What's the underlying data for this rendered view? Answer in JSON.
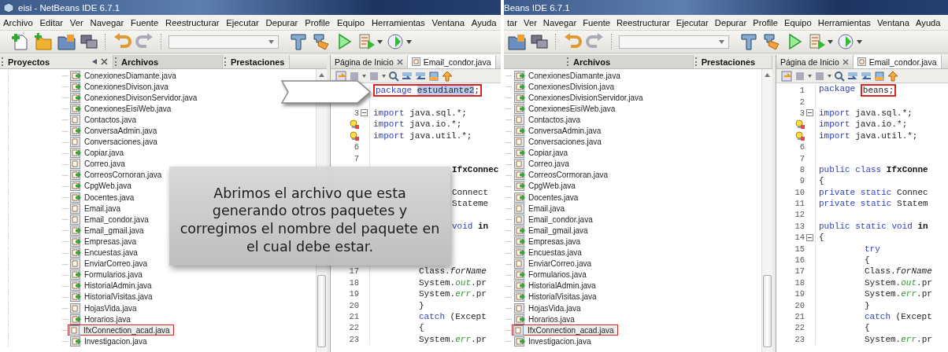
{
  "screens": [
    {
      "title": "eisi - NetBeans IDE 6.7.1",
      "menu": [
        "Archivo",
        "Editar",
        "Ver",
        "Navegar",
        "Fuente",
        "Reestructurar",
        "Ejecutar",
        "Depurar",
        "Profile",
        "Equipo",
        "Herramientas",
        "Ventana",
        "Ayuda"
      ],
      "toolbar": [
        {
          "kind": "new-file"
        },
        {
          "kind": "new-project"
        },
        {
          "kind": "open-project"
        },
        {
          "kind": "close-project"
        },
        {
          "kind": "sep"
        },
        {
          "kind": "undo"
        },
        {
          "kind": "redo"
        },
        {
          "kind": "sep"
        },
        {
          "kind": "combo"
        },
        {
          "kind": "build"
        },
        {
          "kind": "clean"
        },
        {
          "kind": "run"
        },
        {
          "kind": "debug"
        },
        {
          "kind": "profile"
        }
      ],
      "panel_tabs": [
        {
          "label": "Proyectos",
          "selected": false
        },
        {
          "label": "Archivos",
          "selected": true
        },
        {
          "label": "Prestaciones",
          "selected": false
        }
      ],
      "editor_tabs": [
        {
          "label": "Página de Inicio",
          "selected": false
        },
        {
          "label": "Email_condor.java",
          "selected": true
        }
      ],
      "files": [
        {
          "name": "ConexionesDiamante.java",
          "kind": "runnable",
          "highlighted": false
        },
        {
          "name": "ConexionesDivison.java",
          "kind": "runnable",
          "highlighted": false
        },
        {
          "name": "ConexionesDivisonServidor.java",
          "kind": "runnable",
          "highlighted": false
        },
        {
          "name": "ConexionesEisiWeb.java",
          "kind": "runnable",
          "highlighted": false
        },
        {
          "name": "Contactos.java",
          "kind": "plain",
          "highlighted": false
        },
        {
          "name": "ConversaAdmin.java",
          "kind": "runnable",
          "highlighted": false
        },
        {
          "name": "Conversaciones.java",
          "kind": "plain",
          "highlighted": false
        },
        {
          "name": "Copiar.java",
          "kind": "runnable",
          "highlighted": false
        },
        {
          "name": "Correo.java",
          "kind": "plain",
          "highlighted": false
        },
        {
          "name": "CorreosCornoran.java",
          "kind": "runnable",
          "highlighted": false
        },
        {
          "name": "CpgWeb.java",
          "kind": "runnable",
          "highlighted": false
        },
        {
          "name": "Docentes.java",
          "kind": "runnable",
          "highlighted": false
        },
        {
          "name": "Email.java",
          "kind": "plain",
          "highlighted": false
        },
        {
          "name": "Email_condor.java",
          "kind": "plain",
          "highlighted": false
        },
        {
          "name": "Email_gmail.java",
          "kind": "runnable",
          "highlighted": false
        },
        {
          "name": "Empresas.java",
          "kind": "runnable",
          "highlighted": false
        },
        {
          "name": "Encuestas.java",
          "kind": "runnable",
          "highlighted": false
        },
        {
          "name": "EnviarCorreo.java",
          "kind": "plain",
          "highlighted": false
        },
        {
          "name": "Formularios.java",
          "kind": "runnable",
          "highlighted": false
        },
        {
          "name": "HistorialAdmin.java",
          "kind": "runnable",
          "highlighted": false
        },
        {
          "name": "HistorialVisitas.java",
          "kind": "runnable",
          "highlighted": false
        },
        {
          "name": "HojasVida.java",
          "kind": "plain",
          "highlighted": false
        },
        {
          "name": "Horarios.java",
          "kind": "runnable",
          "highlighted": false
        },
        {
          "name": "IfxConnection_acad.java",
          "kind": "plain",
          "highlighted": true
        },
        {
          "name": "Investigacion.java",
          "kind": "runnable",
          "highlighted": false
        }
      ],
      "code": [
        {
          "segments": [
            {
              "text": "package ",
              "kind": "kw",
              "boxed": true,
              "selected": false
            },
            {
              "text": "estudiante2",
              "kind": "plain",
              "boxed": true,
              "selected": true
            },
            {
              "text": ";",
              "kind": "plain",
              "boxed": true,
              "selected": false
            }
          ]
        },
        {
          "kind": "blank"
        },
        {
          "number": "3",
          "kind": "fold",
          "segments": [
            {
              "text": "import ",
              "kind": "kw"
            },
            {
              "text": "java.sql.*;",
              "kind": "plain"
            }
          ]
        },
        {
          "kind": "bulb",
          "segments": [
            {
              "text": "import ",
              "kind": "kw"
            },
            {
              "text": "java.io.*;",
              "kind": "plain"
            }
          ]
        },
        {
          "kind": "bulb",
          "segments": [
            {
              "text": "import ",
              "kind": "kw"
            },
            {
              "text": "java.util.*;",
              "kind": "plain"
            }
          ]
        },
        {
          "number": "6"
        },
        {
          "number": "7"
        },
        {
          "partly_covered": true,
          "segments": [
            {
              "text": "IfxConnec",
              "kind": "bold"
            }
          ]
        },
        {
          "kind": "blank"
        },
        {
          "partly_covered": true,
          "segments": [
            {
              "text": "Connect",
              "kind": "plain"
            }
          ]
        },
        {
          "partly_covered": true,
          "segments": [
            {
              "text": "Stateme",
              "kind": "plain"
            }
          ]
        },
        {
          "kind": "blank"
        },
        {
          "partly_covered": true,
          "segments": [
            {
              "text": "void ",
              "kind": "kw"
            },
            {
              "text": "in",
              "kind": "bold"
            }
          ]
        },
        {
          "kind": "blank"
        },
        {
          "kind": "blank"
        },
        {
          "kind": "blank"
        },
        {
          "number": "17",
          "indented": true,
          "segments": [
            {
              "text": "Class.",
              "kind": "plain"
            },
            {
              "text": "forName",
              "kind": "italic"
            }
          ]
        },
        {
          "number": "18",
          "indented": true,
          "segments": [
            {
              "text": "System.",
              "kind": "plain"
            },
            {
              "text": "out",
              "kind": "field"
            },
            {
              "text": ".pr",
              "kind": "plain"
            }
          ]
        },
        {
          "number": "19",
          "indented": true,
          "segments": [
            {
              "text": "System.",
              "kind": "plain"
            },
            {
              "text": "err",
              "kind": "field"
            },
            {
              "text": ".pr",
              "kind": "plain"
            }
          ]
        },
        {
          "number": "20",
          "indented": true,
          "segments": [
            {
              "text": "}",
              "kind": "plain"
            }
          ]
        },
        {
          "number": "21",
          "indented": true,
          "segments": [
            {
              "text": "catch ",
              "kind": "kw"
            },
            {
              "text": "(Except",
              "kind": "plain"
            }
          ]
        },
        {
          "number": "22",
          "indented": true,
          "segments": [
            {
              "text": "{",
              "kind": "plain"
            }
          ]
        },
        {
          "number": "23",
          "indented": true,
          "segments": [
            {
              "text": "System.",
              "kind": "plain"
            },
            {
              "text": "err",
              "kind": "field"
            },
            {
              "text": ".pr",
              "kind": "plain"
            }
          ]
        }
      ]
    },
    {
      "title": "Beans IDE 6.7.1",
      "menu": [
        "tar",
        "Ver",
        "Navegar",
        "Fuente",
        "Reestructurar",
        "Ejecutar",
        "Depurar",
        "Profile",
        "Equipo",
        "Herramientas",
        "Ventana",
        "Ayuda"
      ],
      "toolbar": [
        {
          "kind": "open-project"
        },
        {
          "kind": "close-project"
        },
        {
          "kind": "sep"
        },
        {
          "kind": "undo"
        },
        {
          "kind": "redo"
        },
        {
          "kind": "sep"
        },
        {
          "kind": "combo"
        },
        {
          "kind": "build"
        },
        {
          "kind": "clean"
        },
        {
          "kind": "run"
        },
        {
          "kind": "debug"
        },
        {
          "kind": "profile"
        }
      ],
      "panel_tabs": [
        {
          "label": "Archivos",
          "selected": true
        },
        {
          "label": "Prestaciones",
          "selected": false
        }
      ],
      "editor_tabs": [
        {
          "label": "Página de Inicio",
          "selected": false
        },
        {
          "label": "Email_condor.java",
          "selected": true
        }
      ],
      "files": [
        {
          "name": "ConexionesDiamante.java",
          "kind": "runnable",
          "highlighted": false
        },
        {
          "name": "ConexionesDivision.java",
          "kind": "runnable",
          "highlighted": false
        },
        {
          "name": "ConexionesDivisionServidor.java",
          "kind": "runnable",
          "highlighted": false
        },
        {
          "name": "ConexionesEisiWeb.java",
          "kind": "runnable",
          "highlighted": false
        },
        {
          "name": "Contactos.java",
          "kind": "plain",
          "highlighted": false
        },
        {
          "name": "ConversaAdmin.java",
          "kind": "runnable",
          "highlighted": false
        },
        {
          "name": "Conversaciones.java",
          "kind": "plain",
          "highlighted": false
        },
        {
          "name": "Copiar.java",
          "kind": "runnable",
          "highlighted": false
        },
        {
          "name": "Correo.java",
          "kind": "plain",
          "highlighted": false
        },
        {
          "name": "CorreosCormoran.java",
          "kind": "runnable",
          "highlighted": false
        },
        {
          "name": "CpgWeb.java",
          "kind": "runnable",
          "highlighted": false
        },
        {
          "name": "Docentes.java",
          "kind": "runnable",
          "highlighted": false
        },
        {
          "name": "Email.java",
          "kind": "plain",
          "highlighted": false
        },
        {
          "name": "Email_condor.java",
          "kind": "plain",
          "highlighted": false
        },
        {
          "name": "Email_gmail.java",
          "kind": "runnable",
          "highlighted": false
        },
        {
          "name": "Empresas.java",
          "kind": "runnable",
          "highlighted": false
        },
        {
          "name": "Encuestas.java",
          "kind": "runnable",
          "highlighted": false
        },
        {
          "name": "EnviarCorreo.java",
          "kind": "plain",
          "highlighted": false
        },
        {
          "name": "Formularios.java",
          "kind": "runnable",
          "highlighted": false
        },
        {
          "name": "HistorialAdmin.java",
          "kind": "runnable",
          "highlighted": false
        },
        {
          "name": "HistorialVisitas.java",
          "kind": "runnable",
          "highlighted": false
        },
        {
          "name": "HojasVida.java",
          "kind": "plain",
          "highlighted": false
        },
        {
          "name": "Horarios.java",
          "kind": "runnable",
          "highlighted": false
        },
        {
          "name": "IfxConnection_acad.java",
          "kind": "plain",
          "highlighted": true
        },
        {
          "name": "Investigacion.java",
          "kind": "runnable",
          "highlighted": false
        }
      ],
      "code": [
        {
          "number": "1",
          "segments": [
            {
              "text": "package ",
              "kind": "kw",
              "boxed": false
            },
            {
              "text": "beans;",
              "kind": "plain",
              "boxed": true
            }
          ]
        },
        {
          "number": "2"
        },
        {
          "number": "3",
          "kind": "fold",
          "segments": [
            {
              "text": "import ",
              "kind": "kw"
            },
            {
              "text": "java.sql.*;",
              "kind": "plain"
            }
          ]
        },
        {
          "kind": "bulb",
          "segments": [
            {
              "text": "import ",
              "kind": "kw"
            },
            {
              "text": "java.io.*;",
              "kind": "plain"
            }
          ]
        },
        {
          "kind": "bulb",
          "segments": [
            {
              "text": "import ",
              "kind": "kw"
            },
            {
              "text": "java.util.*;",
              "kind": "plain"
            }
          ]
        },
        {
          "number": "6"
        },
        {
          "number": "7"
        },
        {
          "number": "8",
          "segments": [
            {
              "text": "public class ",
              "kind": "kw"
            },
            {
              "text": "IfxConne",
              "kind": "bold"
            }
          ]
        },
        {
          "number": "9",
          "segments": [
            {
              "text": "{",
              "kind": "plain"
            }
          ]
        },
        {
          "number": "10",
          "segments": [
            {
              "text": "private static ",
              "kind": "kw"
            },
            {
              "text": "Connec",
              "kind": "plain"
            }
          ]
        },
        {
          "number": "11",
          "segments": [
            {
              "text": "private static ",
              "kind": "kw"
            },
            {
              "text": "Statem",
              "kind": "plain"
            }
          ]
        },
        {
          "number": "12"
        },
        {
          "number": "13",
          "segments": [
            {
              "text": "public static void ",
              "kind": "kw"
            },
            {
              "text": "in",
              "kind": "bold"
            }
          ]
        },
        {
          "number": "14",
          "kind": "fold",
          "segments": [
            {
              "text": "{",
              "kind": "plain"
            }
          ]
        },
        {
          "number": "15",
          "indented": true,
          "segments": [
            {
              "text": "try",
              "kind": "kw"
            }
          ]
        },
        {
          "number": "16",
          "indented": true,
          "segments": [
            {
              "text": "{",
              "kind": "plain"
            }
          ]
        },
        {
          "number": "17",
          "indented": true,
          "segments": [
            {
              "text": "Class.",
              "kind": "plain"
            },
            {
              "text": "forName",
              "kind": "italic"
            }
          ]
        },
        {
          "number": "18",
          "indented": true,
          "segments": [
            {
              "text": "System.",
              "kind": "plain"
            },
            {
              "text": "out",
              "kind": "field"
            },
            {
              "text": ".pr",
              "kind": "plain"
            }
          ]
        },
        {
          "number": "19",
          "indented": true,
          "segments": [
            {
              "text": "System.",
              "kind": "plain"
            },
            {
              "text": "err",
              "kind": "field"
            },
            {
              "text": ".pr",
              "kind": "plain"
            }
          ]
        },
        {
          "number": "20",
          "indented": true,
          "segments": [
            {
              "text": "}",
              "kind": "plain"
            }
          ]
        },
        {
          "number": "21",
          "indented": true,
          "segments": [
            {
              "text": "catch ",
              "kind": "kw"
            },
            {
              "text": "(Except",
              "kind": "plain"
            }
          ]
        },
        {
          "number": "22",
          "indented": true,
          "segments": [
            {
              "text": "{",
              "kind": "plain"
            }
          ]
        },
        {
          "number": "23",
          "indented": true,
          "segments": [
            {
              "text": "System.",
              "kind": "plain"
            },
            {
              "text": "err",
              "kind": "field"
            },
            {
              "text": ".pr",
              "kind": "plain"
            }
          ]
        }
      ]
    }
  ],
  "callout": {
    "text": "Abrimos el archivo que esta generando otros paquetes y corregimos el nombre del paquete en el cual debe estar."
  }
}
